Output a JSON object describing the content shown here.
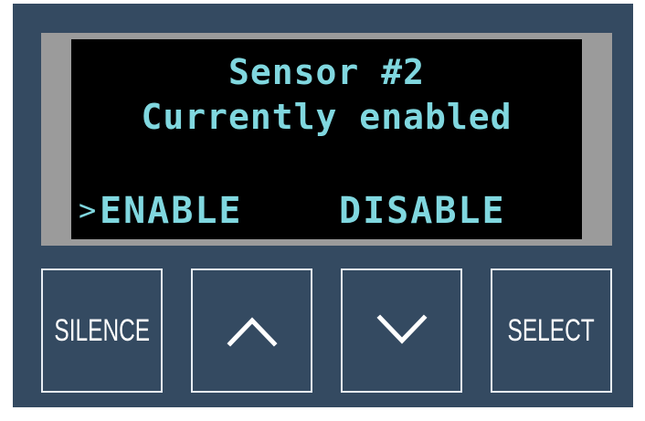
{
  "display": {
    "line1": "Sensor #2",
    "line2": "Currently enabled",
    "cursor": ">",
    "options": [
      "ENABLE",
      "DISABLE"
    ],
    "selected_option": "ENABLE"
  },
  "buttons": {
    "silence_label": "SILENCE",
    "up_icon": "chevron-up-icon",
    "down_icon": "chevron-down-icon",
    "select_label": "SELECT"
  },
  "colors": {
    "panel": "#344a61",
    "bezel": "#9b9b9b",
    "lcd_background": "#000000",
    "lcd_text": "#80d7df",
    "button_border": "#e8eef4"
  }
}
